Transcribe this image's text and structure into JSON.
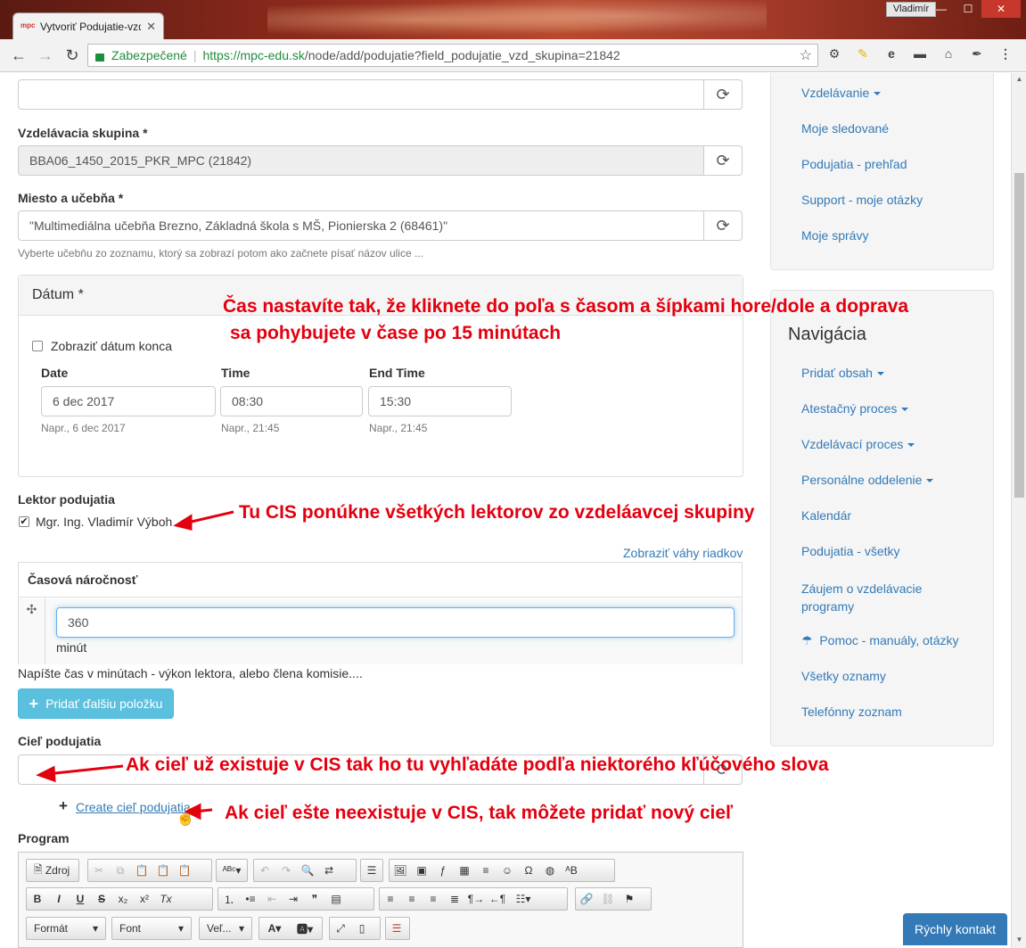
{
  "browser": {
    "tab_title": "Vytvoriť Podujatie-vzdelavanie",
    "favicon_text": "mpc",
    "user_badge": "Vladimír",
    "secure_label": "Zabezpečené",
    "url_scheme_host": "https://mpc-edu.sk",
    "url_path": "/node/add/podujatie?field_podujatie_vzd_skupina=21842",
    "window_buttons": {
      "minimize": "—",
      "maximize": "☐",
      "close": "✕"
    }
  },
  "form": {
    "top_field_value": "",
    "group": {
      "label": "Vzdelávacia skupina *",
      "value": "BBA06_1450_2015_PKR_MPC (21842)"
    },
    "place": {
      "label": "Miesto a učebňa *",
      "value": "\"Multimediálna učebňa Brezno, Základná škola s MŠ, Pionierska 2 (68461)\"",
      "help": "Vyberte učebňu zo zoznamu, ktorý sa zobrazí potom ako začnete písať názov ulice ..."
    },
    "datum": {
      "heading": "Dátum *",
      "show_end_label": "Zobraziť dátum konca",
      "date_label": "Date",
      "date_value": "6 dec 2017",
      "date_help": "Napr., 6 dec 2017",
      "time_label": "Time",
      "time_value": "08:30",
      "time_help": "Napr., 21:45",
      "end_label": "End Time",
      "end_value": "15:30",
      "end_help": "Napr., 21:45"
    },
    "lector": {
      "label": "Lektor podujatia",
      "name": "Mgr. Ing. Vladimír Výboh",
      "checked": true
    },
    "weights_link": "Zobraziť váhy riadkov",
    "time_demand": {
      "header": "Časová náročnosť",
      "value": "360",
      "unit": "minút",
      "help": "Napíšte čas v minútach - výkon lektora, alebo člena komisie....",
      "drag_icon": "✣"
    },
    "add_item_button": "Pridať ďalšiu položku",
    "goal": {
      "label": "Cieľ podujatia",
      "value": "",
      "create_link": "Create cieľ podujatia"
    },
    "program": {
      "label": "Program",
      "toolbar": {
        "source": "Zdroj",
        "format": "Formát",
        "font": "Font",
        "size": "Veľ..."
      }
    }
  },
  "sidebar": {
    "top_links": [
      "Vzdelávanie",
      "Moje sledované",
      "Podujatia - prehľad",
      "Support - moje otázky",
      "Moje správy"
    ],
    "nav_title": "Navigácia",
    "nav_links": [
      "Pridať obsah",
      "Atestačný proces",
      "Vzdelávací proces",
      "Personálne oddelenie",
      "Kalendár",
      "Podujatia - všetky",
      "Záujem o vzdelávacie programy",
      "Pomoc - manuály, otázky",
      "Všetky oznamy",
      "Telefónny zoznam"
    ]
  },
  "quick_contact": "Rýchly kontakt",
  "annotations": {
    "time_line1": "Čas nastavíte tak, že kliknete do poľa s časom a šípkami hore/dole a doprava",
    "time_line2": "sa pohybujete v čase po 15 minútach",
    "lector": "Tu CIS ponúkne všetkých lektorov zo vzdeláavcej skupiny",
    "goal_search": "Ak cieľ už existuje v CIS tak ho tu vyhľadáte podľa niektorého kľúčového slova",
    "goal_create": "Ak cieľ ešte neexistuje v CIS, tak môžete pridať nový cieľ"
  },
  "colors": {
    "link": "#337ab7",
    "annotation": "#e3000f",
    "info_button": "#5bc0de",
    "secure_green": "#1e8e3e"
  }
}
